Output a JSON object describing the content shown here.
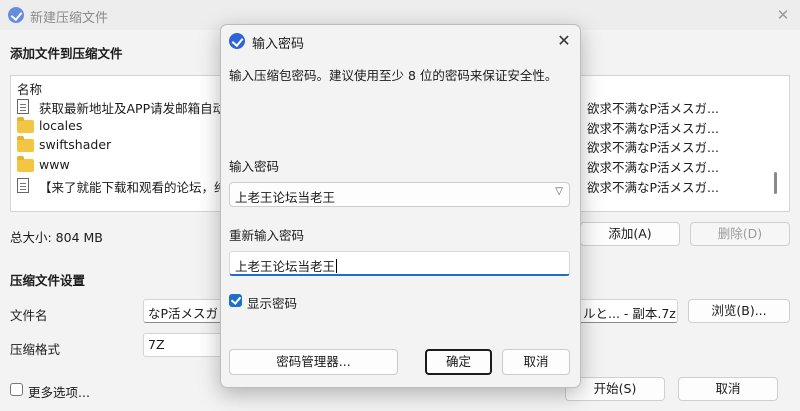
{
  "main_window": {
    "title": "新建压缩文件",
    "add_files_heading": "添加文件到压缩文件",
    "file_list": {
      "column_name": "名称",
      "rows": [
        {
          "icon": "document-icon",
          "name": "获取最新地址及APP请发邮箱自动",
          "desc": "欲求不满なP活メスガ..."
        },
        {
          "icon": "folder-icon",
          "name": "locales",
          "desc": "欲求不满なP活メスガ..."
        },
        {
          "icon": "folder-icon",
          "name": "swiftshader",
          "desc": "欲求不满なP活メスガ..."
        },
        {
          "icon": "folder-icon",
          "name": "www",
          "desc": "欲求不满なP活メスガ..."
        },
        {
          "icon": "document-icon",
          "name": "【来了就能下载和观看的论坛，纯",
          "desc": "欲求不满なP活メスガ..."
        }
      ]
    },
    "total_size": "总大小: 804 MB",
    "add_button": "添加(A)",
    "delete_button": "删除(D)",
    "settings_heading": "压缩文件设置",
    "filename_label": "文件名",
    "filename_value_left": "なP活メスガ",
    "filename_value_right": "ルと... - 副本.7z",
    "browse_button": "浏览(B)...",
    "format_label": "压缩格式",
    "format_value": "7Z",
    "more_options_label": "更多选项...",
    "start_button": "开始(S)",
    "cancel_button": "取消"
  },
  "dialog": {
    "title": "输入密码",
    "description": "输入压缩包密码。建议使用至少 8 位的密码来保证安全性。",
    "password_label": "输入密码",
    "password_value": "上老王论坛当老王",
    "reenter_label": "重新输入密码",
    "reenter_value": "上老王论坛当老王",
    "show_password_label": "显示密码",
    "show_password_checked": true,
    "password_manager_button": "密码管理器...",
    "ok_button": "确定",
    "cancel_button": "取消"
  },
  "colors": {
    "accent": "#1f6fc9",
    "app_icon": "#2f63d8",
    "folder": "#f4c542"
  }
}
